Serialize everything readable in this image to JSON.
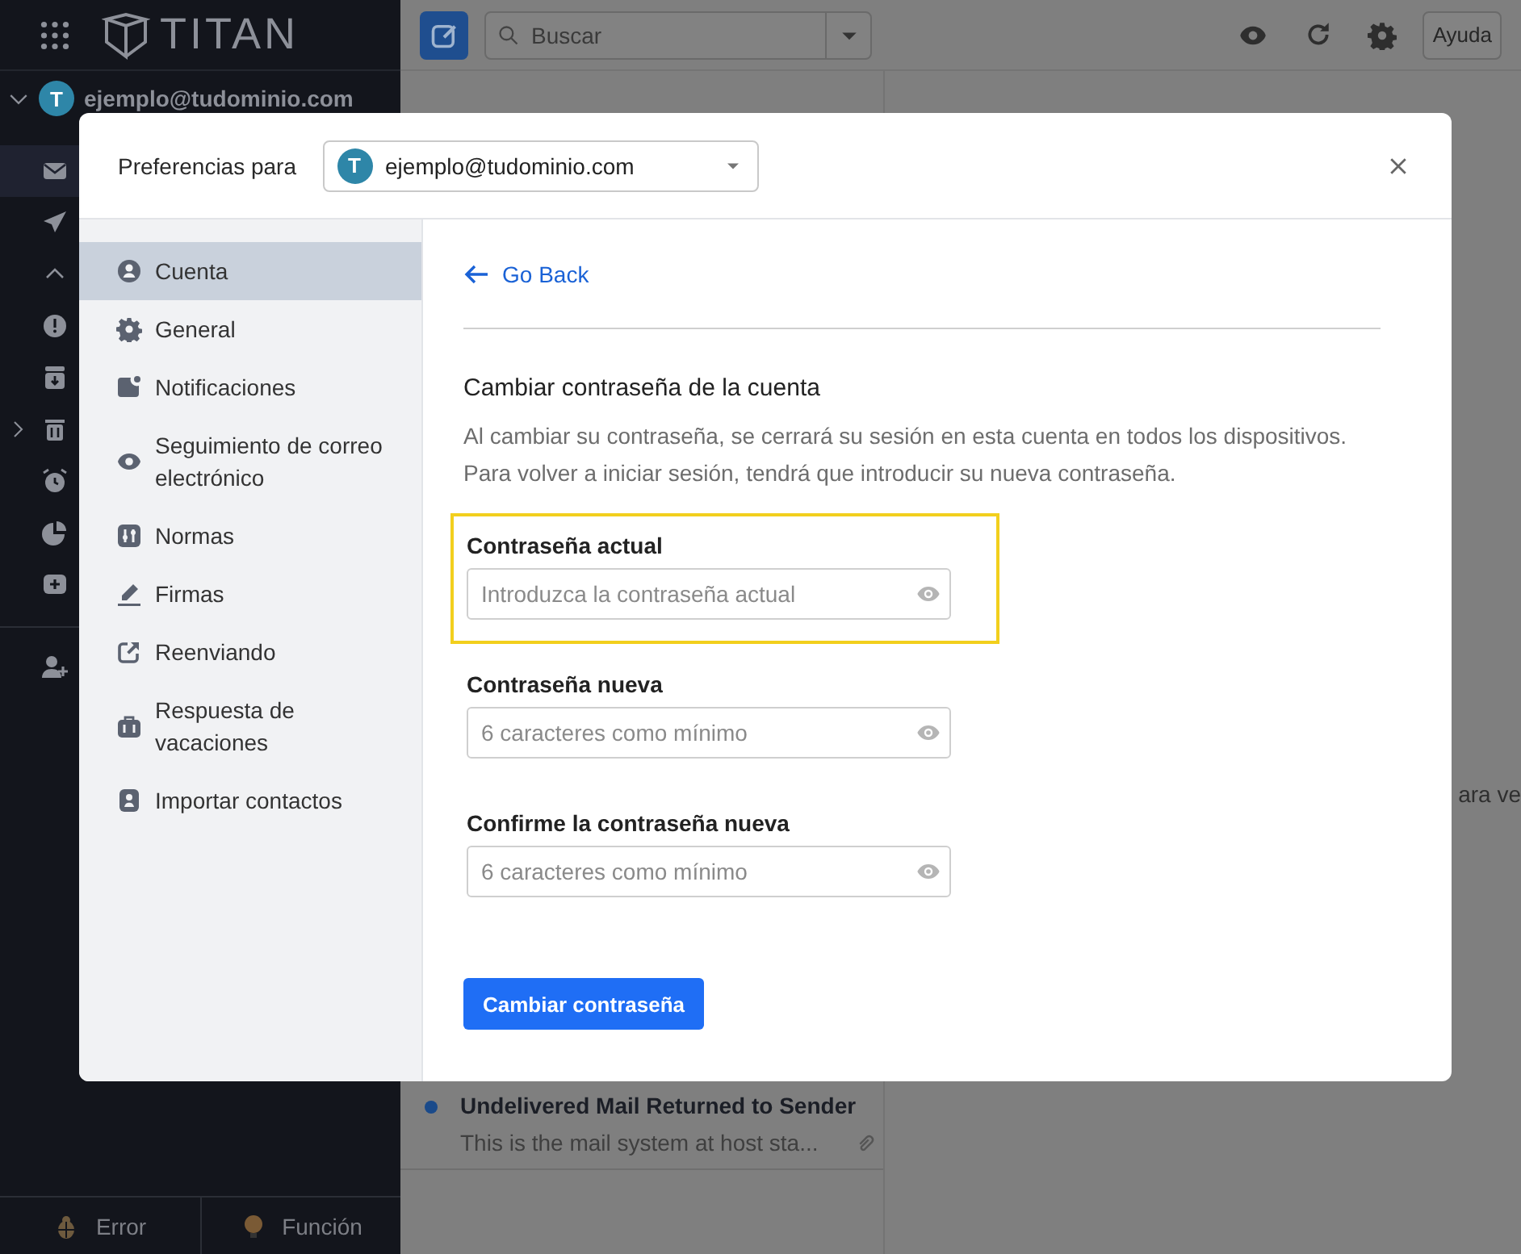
{
  "app": {
    "logo": "TITAN",
    "search": {
      "placeholder": "Buscar"
    },
    "help_button": "Ayuda",
    "account": {
      "avatar": "T",
      "email": "ejemplo@tudominio.com"
    },
    "message": {
      "unread": true,
      "subject": "Undelivered Mail Returned to Sender",
      "preview": "This is the mail system at host sta..."
    },
    "reading_pane_text": "ara ve",
    "bottom_bar": [
      {
        "kind": "bug",
        "label": "Error"
      },
      {
        "kind": "bulb",
        "label": "Función"
      }
    ]
  },
  "dialog": {
    "title": "Preferencias para",
    "account_select": {
      "avatar": "T",
      "value": "ejemplo@tudominio.com"
    },
    "nav": [
      {
        "label": "Cuenta",
        "selected": true
      },
      {
        "label": "General",
        "selected": false
      },
      {
        "label": "Notificaciones",
        "selected": false
      },
      {
        "label": "Seguimiento de correo electrónico",
        "selected": false
      },
      {
        "label": "Normas",
        "selected": false
      },
      {
        "label": "Firmas",
        "selected": false
      },
      {
        "label": "Reenviando",
        "selected": false
      },
      {
        "label": "Respuesta de vacaciones",
        "selected": false
      },
      {
        "label": "Importar contactos",
        "selected": false
      }
    ],
    "back_link": "Go Back",
    "section_title": "Cambiar contraseña de la cuenta",
    "description": "Al cambiar su contraseña, se cerrará su sesión en esta cuenta en todos los dispositivos. Para volver a iniciar sesión, tendrá que introducir su nueva contraseña.",
    "fields": [
      {
        "label": "Contraseña actual",
        "placeholder": "Introduzca la contraseña actual",
        "highlighted": true
      },
      {
        "label": "Contraseña nueva",
        "placeholder": "6 caracteres como mínimo",
        "highlighted": false
      },
      {
        "label": "Confirme la contraseña nueva",
        "placeholder": "6 caracteres como mínimo",
        "highlighted": false
      }
    ],
    "submit_button": "Cambiar contraseña"
  }
}
